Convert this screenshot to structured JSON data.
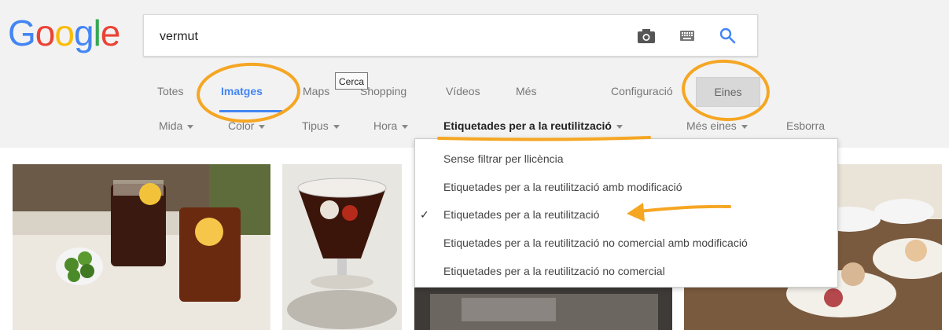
{
  "logo": {
    "letters": [
      "G",
      "o",
      "o",
      "g",
      "l",
      "e"
    ],
    "colors": [
      "#4285f4",
      "#ea4335",
      "#fbbc05",
      "#4285f4",
      "#34a853",
      "#ea4335"
    ]
  },
  "search": {
    "query": "vermut"
  },
  "icons": {
    "camera": "camera-icon",
    "keyboard": "keyboard-icon",
    "search": "search-icon"
  },
  "tabs": [
    {
      "label": "Totes"
    },
    {
      "label": "Imatges"
    },
    {
      "label": "Maps"
    },
    {
      "label": "Shopping"
    },
    {
      "label": "Vídeos"
    },
    {
      "label": "Més"
    }
  ],
  "tooltip": "Cerca",
  "settings_label": "Configuració",
  "tools_label": "Eines",
  "filters": [
    {
      "label": "Mida"
    },
    {
      "label": "Color"
    },
    {
      "label": "Tipus"
    },
    {
      "label": "Hora"
    },
    {
      "label": "Etiquetades per a la reutilització"
    },
    {
      "label": "Més eines"
    }
  ],
  "clear_label": "Esborra",
  "license_menu": {
    "selected_index": 2,
    "check": "✓",
    "options": [
      "Sense filtrar per llicència",
      "Etiquetades per a la reutilització amb modificació",
      "Etiquetades per a la reutilització",
      "Etiquetades per a la reutilització no comercial amb modificació",
      "Etiquetades per a la reutilització no comercial"
    ]
  },
  "colors": {
    "accent": "#4285f4",
    "annotation": "#f5a623",
    "header_bg": "#f2f2f2"
  }
}
